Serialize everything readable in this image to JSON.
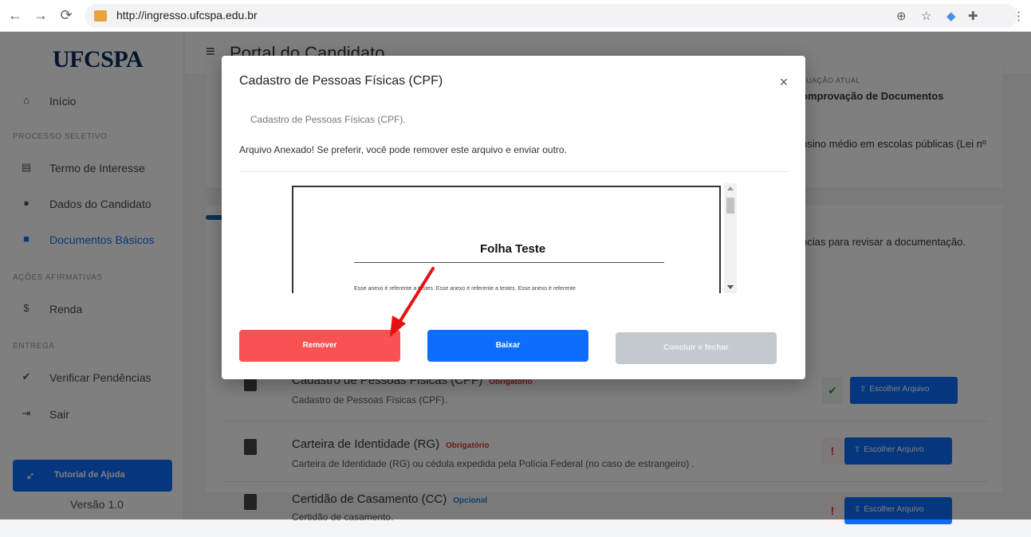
{
  "browser": {
    "url": "http://ingresso.ufcspa.edu.br",
    "icons": [
      "back-icon",
      "forward-icon",
      "reload-icon",
      "zoom-icon",
      "star-icon",
      "extension-icon",
      "puzzle-icon",
      "menu-icon"
    ]
  },
  "sidebar": {
    "logo": "UFCSPA",
    "home": "Início",
    "section_process": "PROCESSO SELETIVO",
    "items_process": [
      "Termo de Interesse",
      "Dados do Candidato",
      "Documentos Básicos"
    ],
    "section_affirm": "AÇÕES AFIRMATIVAS",
    "items_affirm": [
      "Renda"
    ],
    "section_delivery": "ENTREGA",
    "items_delivery": [
      "Verificar Pendências",
      "Sair"
    ],
    "tutorial_label": "Tutorial de Ajuda",
    "version": "Versão 1.0"
  },
  "header": {
    "title": "Portal do Candidato"
  },
  "status": {
    "label": "TUAÇÃO ATUAL",
    "value": "omprovação de Documentos",
    "description": "nsino médio em escolas públicas (Lei nº",
    "pending_note": "ncias para revisar a documentação."
  },
  "documents": [
    {
      "title": "Cadastro de Pessoas Físicas (CPF)",
      "tag": "Obrigatório",
      "tag_color": "#e03131",
      "description": "Cadastro de Pessoas Físicas (CPF).",
      "status": "ok",
      "status_symbol": "✔",
      "button": "Escolher Arquivo"
    },
    {
      "title": "Carteira de Identidade (RG)",
      "tag": "Obrigatório",
      "tag_color": "#e03131",
      "description": "Carteira de Identidade (RG) ou cédula expedida pela Polícia Federal (no caso de estrangeiro) .",
      "status": "warning",
      "status_symbol": "!",
      "button": "Escolher Arquivo"
    },
    {
      "title": "Certidão de Casamento (CC)",
      "tag": "Opcional",
      "tag_color": "#1c7ed6",
      "description": "Certidão de casamento.",
      "status": "warning",
      "status_symbol": "!",
      "button": "Escolher Arquivo"
    }
  ],
  "modal": {
    "title": "Cadastro de Pessoas Físicas (CPF)",
    "close_symbol": "×",
    "description": "Cadastro de Pessoas Físicas (CPF).",
    "message": "Arquivo Anexado! Se preferir, você pode remover este arquivo e enviar outro.",
    "preview": {
      "heading": "Folha Teste",
      "paragraph": "Esse anexo é referente a testes. Esse anexo é referente a testes. Esse anexo é referente"
    },
    "buttons": {
      "remove": "Remover",
      "download": "Baixar",
      "finish": "Concluir e fechar"
    }
  },
  "colors": {
    "primary": "#0d6efd",
    "danger": "#fa5252",
    "disabled": "#c4c9d0",
    "annotation_arrow": "#e81010"
  }
}
